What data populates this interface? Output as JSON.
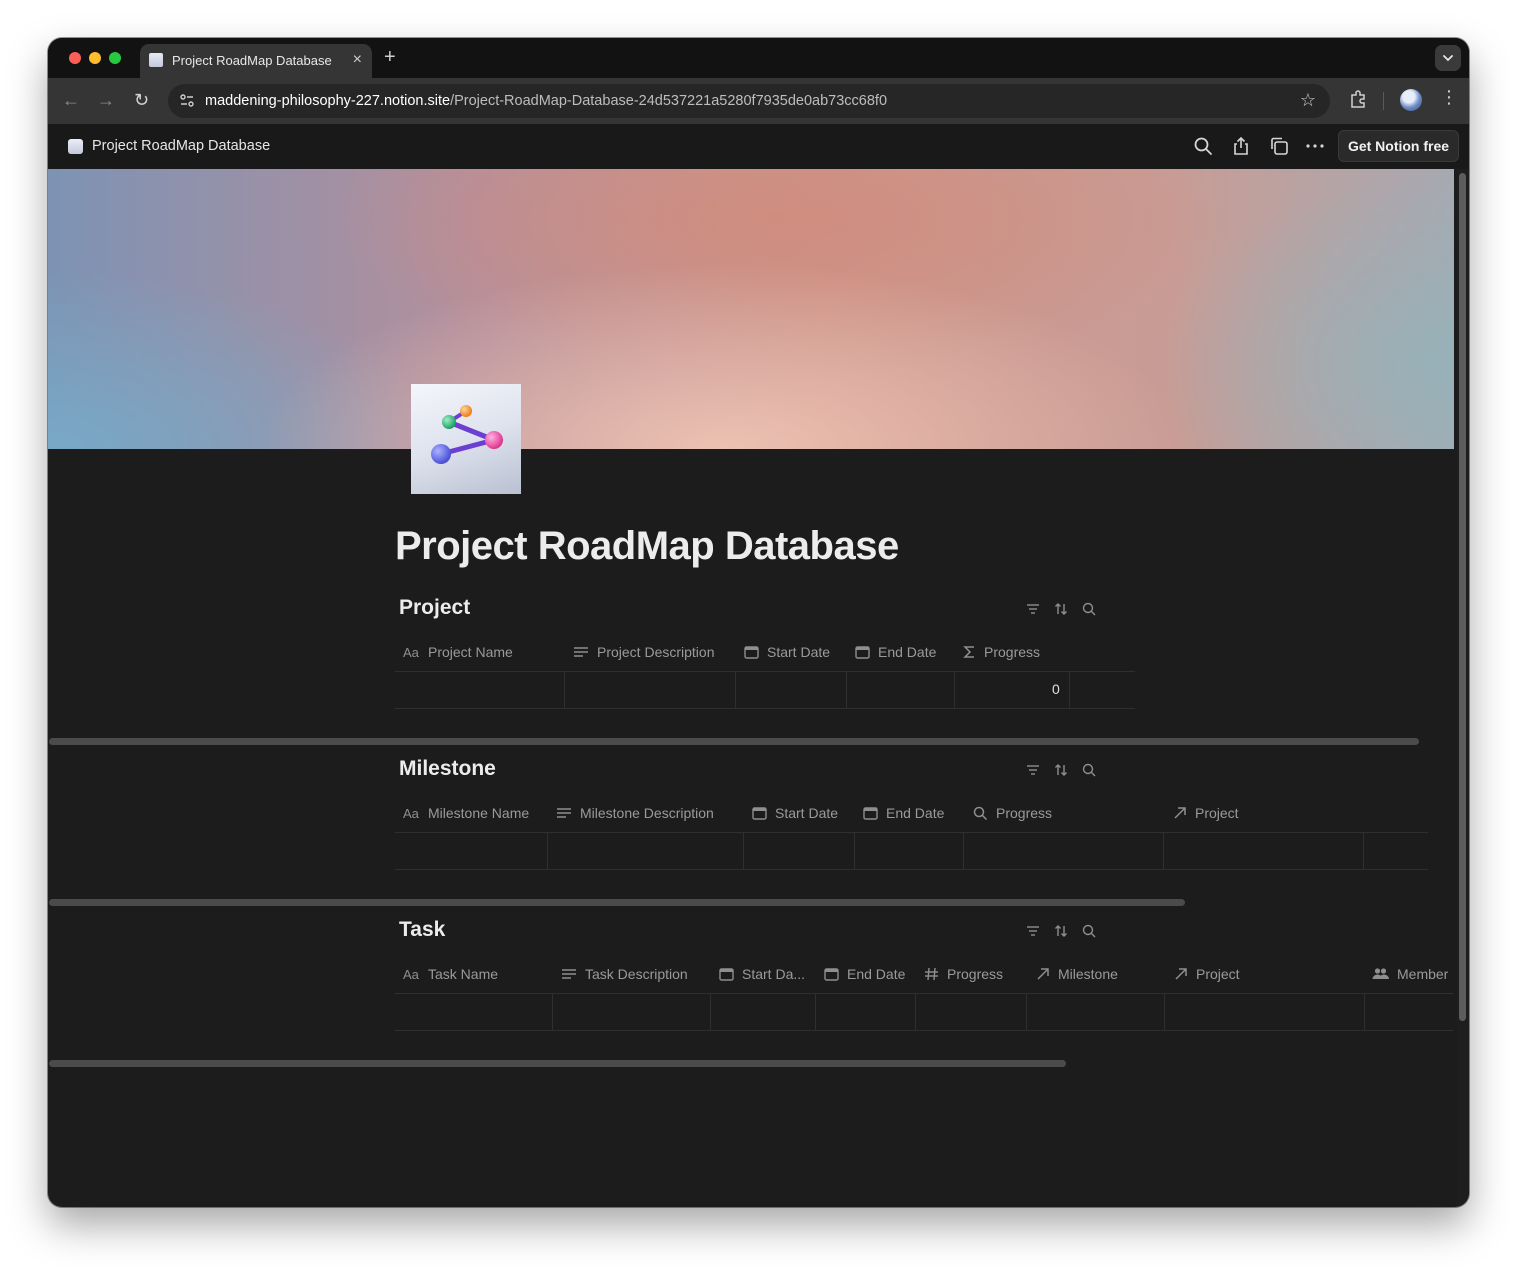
{
  "browser": {
    "tab_title": "Project RoadMap Database",
    "url_host": "maddening-philosophy-227.notion.site",
    "url_path": "/Project-RoadMap-Database-24d537221a5280f7935de0ab73cc68f0"
  },
  "notion_bar": {
    "title": "Project RoadMap Database",
    "get_notion_label": "Get Notion free",
    "icons": [
      "search-icon",
      "share-icon",
      "duplicate-icon",
      "more-icon"
    ]
  },
  "page": {
    "title": "Project RoadMap Database",
    "icon": "roadmap-nodes-icon"
  },
  "databases": {
    "project": {
      "title": "Project",
      "columns": [
        {
          "label": "Project Name",
          "icon": "title-icon"
        },
        {
          "label": "Project Description",
          "icon": "text-icon"
        },
        {
          "label": "Start Date",
          "icon": "calendar-icon"
        },
        {
          "label": "End Date",
          "icon": "calendar-icon"
        },
        {
          "label": "Progress",
          "icon": "sigma-icon"
        }
      ],
      "rows": [
        {
          "progress": "0"
        }
      ]
    },
    "milestone": {
      "title": "Milestone",
      "columns": [
        {
          "label": "Milestone Name",
          "icon": "title-icon"
        },
        {
          "label": "Milestone Description",
          "icon": "text-icon"
        },
        {
          "label": "Start Date",
          "icon": "calendar-icon"
        },
        {
          "label": "End Date",
          "icon": "calendar-icon"
        },
        {
          "label": "Progress",
          "icon": "search-icon"
        },
        {
          "label": "Project",
          "icon": "relation-arrow-icon"
        }
      ]
    },
    "task": {
      "title": "Task",
      "columns": [
        {
          "label": "Task Name",
          "icon": "title-icon"
        },
        {
          "label": "Task Description",
          "icon": "text-icon"
        },
        {
          "label": "Start Da...",
          "icon": "calendar-icon"
        },
        {
          "label": "End Date",
          "icon": "calendar-icon"
        },
        {
          "label": "Progress",
          "icon": "number-icon"
        },
        {
          "label": "Milestone",
          "icon": "relation-arrow-icon"
        },
        {
          "label": "Project",
          "icon": "relation-arrow-icon"
        },
        {
          "label": "Member",
          "icon": "people-icon"
        }
      ]
    }
  },
  "colors": {
    "background": "#191919",
    "text": "#ececec",
    "muted_text": "#9a9a9a",
    "button_bg": "#2a2a2a"
  }
}
